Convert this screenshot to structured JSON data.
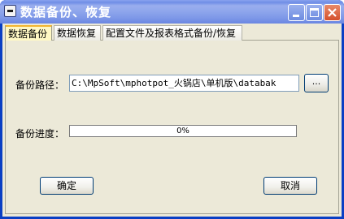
{
  "window": {
    "title": "数据备份、恢复",
    "icon": "system-menu-icon",
    "buttons": {
      "minimize_icon": "minimize-icon",
      "maximize_icon": "maximize-icon",
      "close_icon": "close-icon"
    }
  },
  "tabs": [
    {
      "label": "数据备份",
      "active": true
    },
    {
      "label": "数据恢复",
      "active": false
    },
    {
      "label": "配置文件及报表格式备份/恢复",
      "active": false
    }
  ],
  "backup": {
    "path_label": "备份路径：",
    "path_value": "C:\\MpSoft\\mphotpot_火锅店\\单机版\\databak",
    "browse_label": "...",
    "progress_label": "备份进度：",
    "progress_value": 0,
    "progress_text": "0%"
  },
  "actions": {
    "ok_label": "确定",
    "cancel_label": "取消"
  },
  "colors": {
    "title_bar": "#7e98e8",
    "window_frame": "#0a3fc4",
    "dialog_bg": "#ece9d8",
    "active_tab_accent": "#f2b530",
    "close_button": "#d4502c"
  }
}
